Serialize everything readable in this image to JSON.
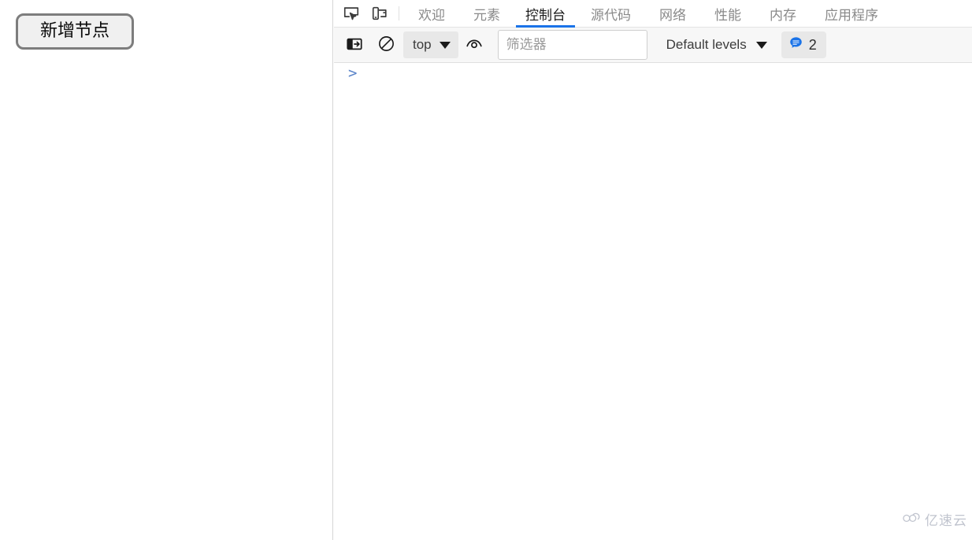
{
  "page": {
    "add_node_button": "新增节点"
  },
  "devtools": {
    "icons": {
      "inspect": "inspect-element-icon",
      "device": "device-toolbar-icon",
      "sidebar": "show-console-sidebar-icon",
      "clear": "clear-console-icon",
      "eye": "live-expression-eye-icon",
      "message": "message-bubble-icon"
    },
    "tabs": [
      {
        "label": "欢迎",
        "active": false
      },
      {
        "label": "元素",
        "active": false
      },
      {
        "label": "控制台",
        "active": true
      },
      {
        "label": "源代码",
        "active": false
      },
      {
        "label": "网络",
        "active": false
      },
      {
        "label": "性能",
        "active": false
      },
      {
        "label": "内存",
        "active": false
      },
      {
        "label": "应用程序",
        "active": false
      }
    ],
    "toolbar": {
      "context": "top",
      "filter_placeholder": "筛选器",
      "filter_value": "",
      "levels": "Default levels",
      "message_count": "2"
    },
    "console": {
      "prompt": ">",
      "input_value": ""
    }
  },
  "watermark": {
    "text": "亿速云"
  },
  "colors": {
    "accent": "#1a73e8",
    "prompt": "#5b84c9",
    "badge_icon": "#1a73e8",
    "tab_inactive": "#8a8a8a",
    "tab_active": "#1a1a1a",
    "toolbar_bg": "#f7f7f7",
    "watermark": "#b6bac6"
  }
}
